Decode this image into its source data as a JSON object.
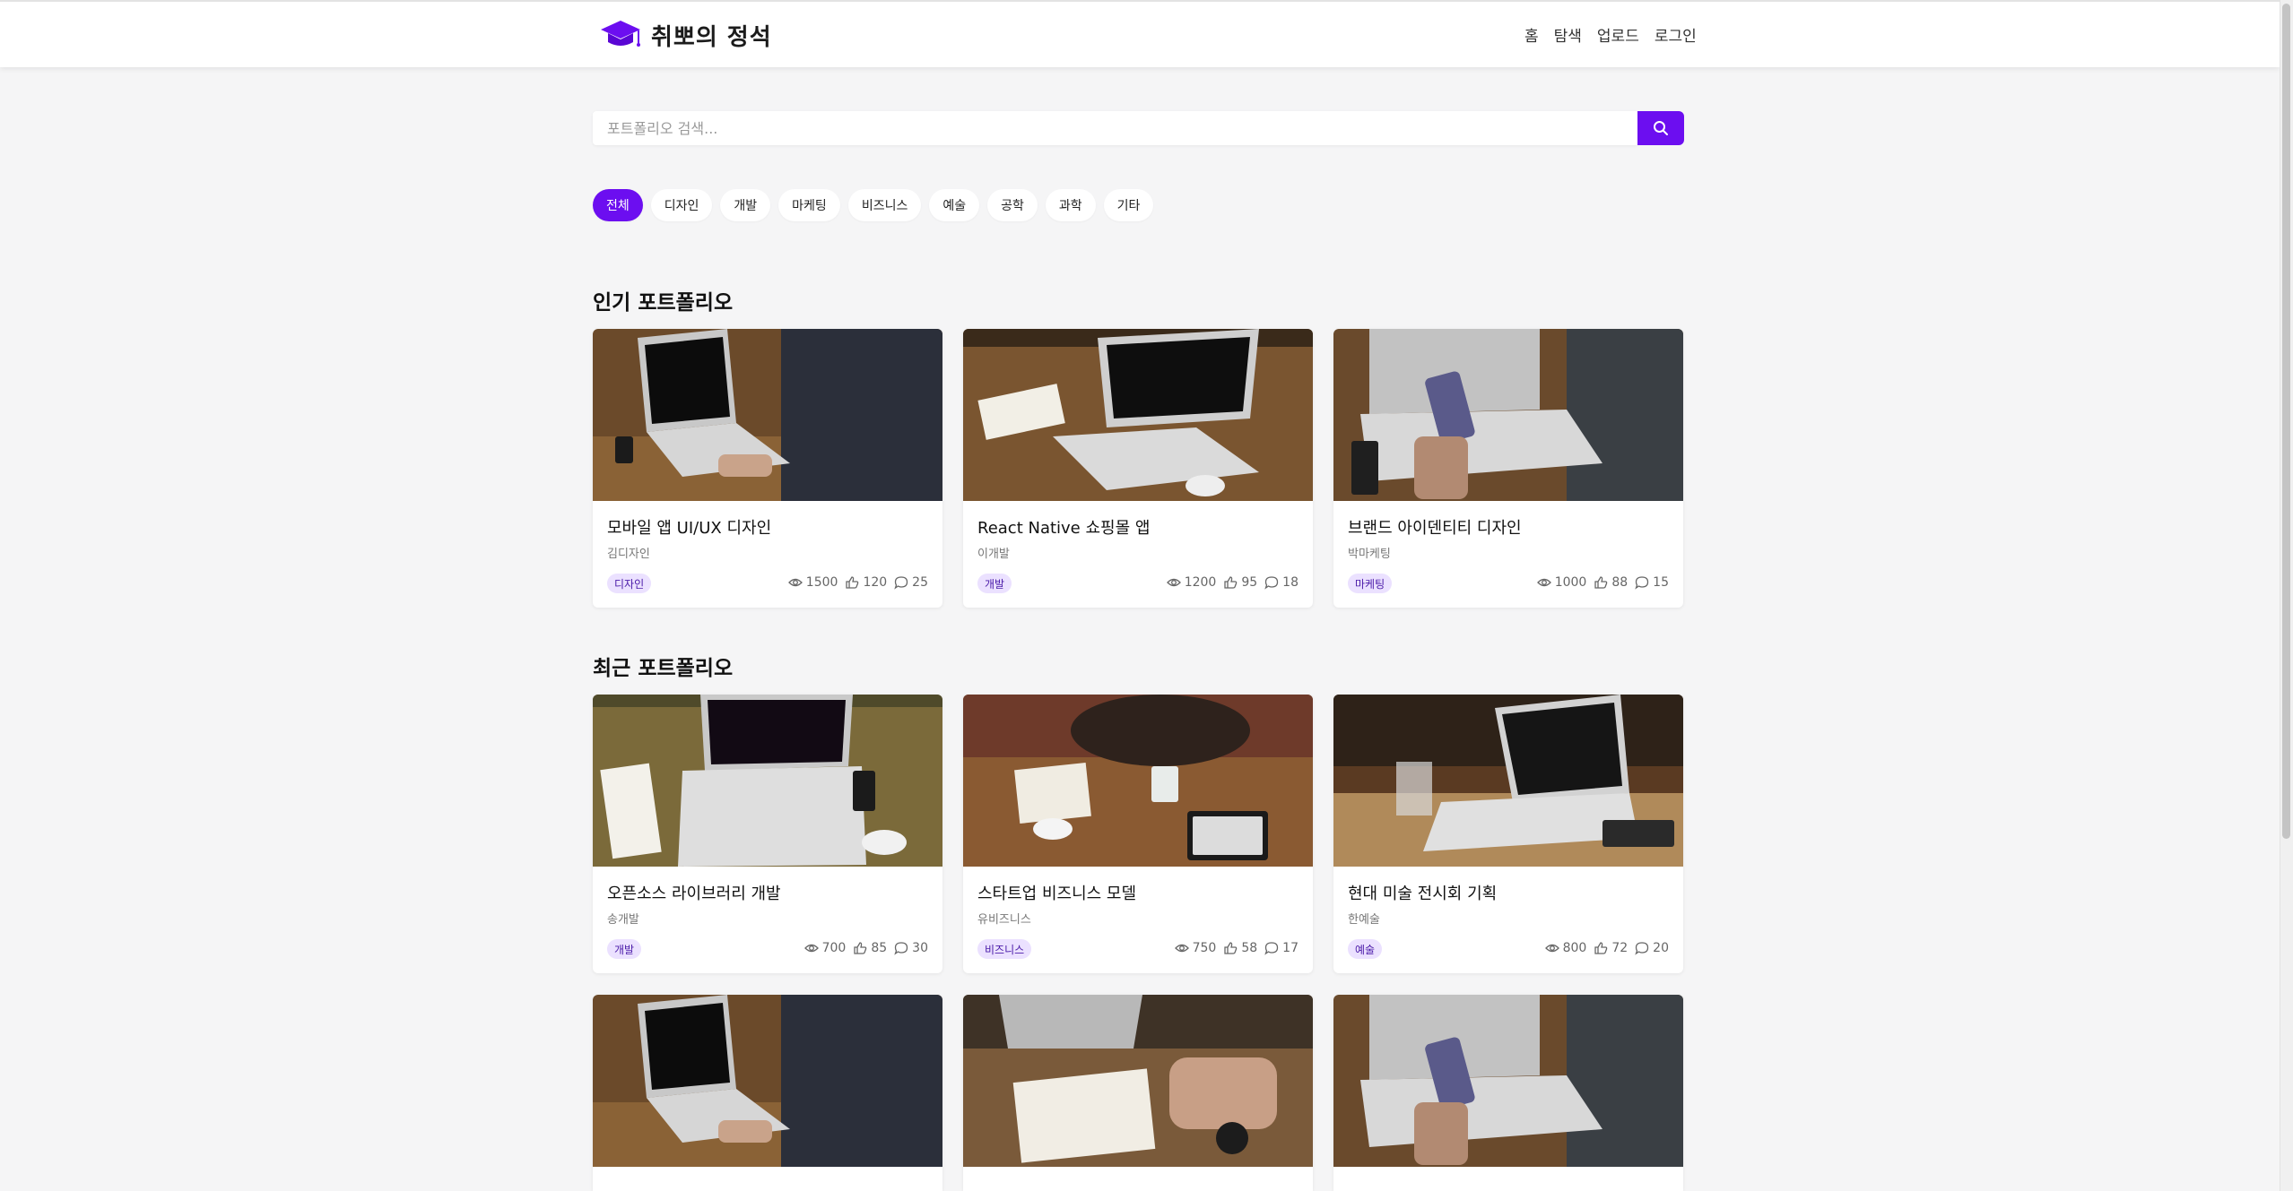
{
  "header": {
    "logo_text": "취뽀의 정석",
    "nav": [
      "홈",
      "탐색",
      "업로드",
      "로그인"
    ]
  },
  "search": {
    "placeholder": "포트폴리오 검색..."
  },
  "categories": [
    "전체",
    "디자인",
    "개발",
    "마케팅",
    "비즈니스",
    "예술",
    "공학",
    "과학",
    "기타"
  ],
  "active_category": "전체",
  "popular": {
    "title": "인기 포트폴리오",
    "cards": [
      {
        "title": "모바일 앱 UI/UX 디자인",
        "author": "김디자인",
        "tag": "디자인",
        "views": "1500",
        "likes": "120",
        "comments": "25"
      },
      {
        "title": "React Native 쇼핑몰 앱",
        "author": "이개발",
        "tag": "개발",
        "views": "1200",
        "likes": "95",
        "comments": "18"
      },
      {
        "title": "브랜드 아이덴티티 디자인",
        "author": "박마케팅",
        "tag": "마케팅",
        "views": "1000",
        "likes": "88",
        "comments": "15"
      }
    ]
  },
  "recent": {
    "title": "최근 포트폴리오",
    "cards": [
      {
        "title": "오픈소스 라이브러리 개발",
        "author": "송개발",
        "tag": "개발",
        "views": "700",
        "likes": "85",
        "comments": "30"
      },
      {
        "title": "스타트업 비즈니스 모델",
        "author": "유비즈니스",
        "tag": "비즈니스",
        "views": "750",
        "likes": "58",
        "comments": "17"
      },
      {
        "title": "현대 미술 전시회 기획",
        "author": "한예술",
        "tag": "예술",
        "views": "800",
        "likes": "72",
        "comments": "20"
      }
    ]
  },
  "colors": {
    "accent": "#6c0ef0",
    "tag_bg": "#ebe1ff",
    "page_bg": "#f5f5f6"
  }
}
